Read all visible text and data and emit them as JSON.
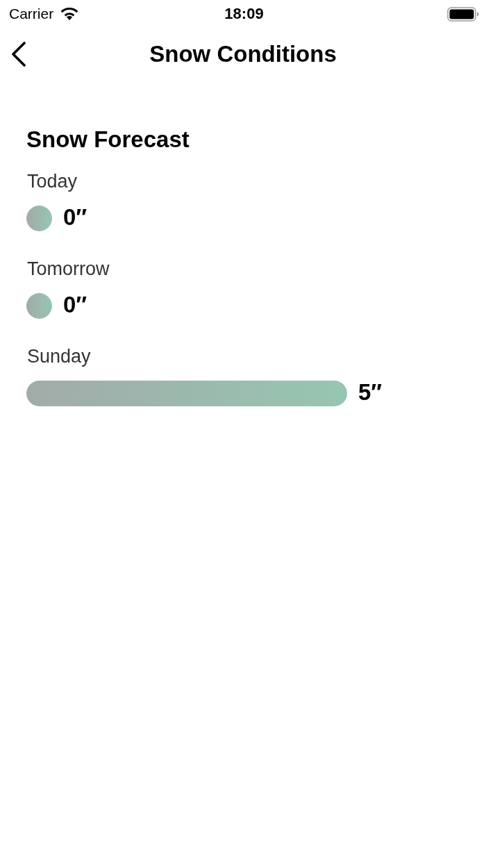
{
  "status_bar": {
    "carrier": "Carrier",
    "time": "18:09"
  },
  "nav_bar": {
    "title": "Snow Conditions"
  },
  "forecast": {
    "chart_data": {
      "type": "bar",
      "title": "Snow Forecast",
      "orientation": "horizontal",
      "categories": [
        "Today",
        "Tomorrow",
        "Sunday"
      ],
      "values": [
        0,
        0,
        5
      ],
      "value_labels": [
        "0″",
        "0″",
        "5″"
      ]
    }
  }
}
